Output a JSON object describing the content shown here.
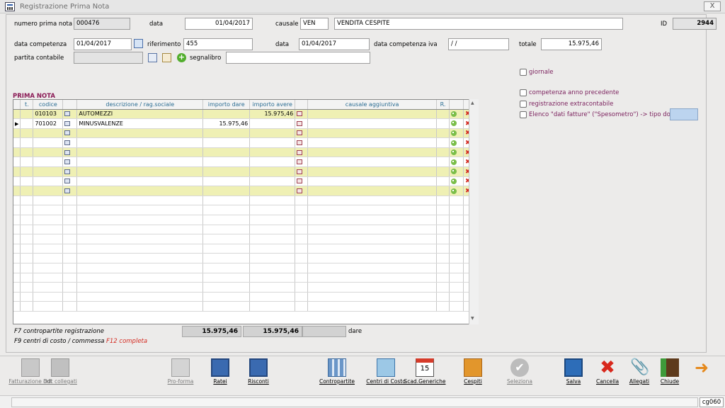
{
  "window": {
    "title": "Registrazione Prima Nota",
    "close_label": "X"
  },
  "header": {
    "numero_label": "numero prima nota",
    "numero_value": "000476",
    "data_label": "data",
    "data_value": "01/04/2017",
    "causale_label": "causale",
    "causale_code": "VEN",
    "causale_desc": "VENDITA CESPITE",
    "id_label": "ID",
    "id_value": "2944",
    "competenza_label": "data competenza",
    "competenza_value": "01/04/2017",
    "riferimento_label": "riferimento",
    "riferimento_value": "455",
    "data2_label": "data",
    "data2_value": "01/04/2017",
    "competenza_iva_label": "data competenza iva",
    "competenza_iva_value": "/ /",
    "totale_label": "totale",
    "totale_value": "15.975,46",
    "partita_label": "partita contabile",
    "partita_value": "",
    "segnalibro_label": "segnalibro",
    "segnalibro_value": ""
  },
  "options": {
    "giornale": "giornale",
    "competenza_precedente": "competenza anno precedente",
    "extracontabile": "registrazione extracontabile",
    "spesometro": "Elenco \"dati fatture\" (\"Spesometro\") -> tipo doc.",
    "tipo_doc_value": ""
  },
  "section_title": "PRIMA NOTA",
  "grid": {
    "columns": [
      "t.",
      "codice",
      "",
      "descrizione / rag.sociale",
      "importo dare",
      "importo avere",
      "",
      "causale aggiuntiva",
      "R.",
      "",
      ""
    ],
    "rows": [
      {
        "codice": "010103",
        "descrizione": "AUTOMEZZI",
        "dare": "",
        "avere": "15.975,46",
        "causale": "",
        "current": false
      },
      {
        "codice": "701002",
        "descrizione": "MINUSVALENZE",
        "dare": "15.975,46",
        "avere": "",
        "causale": "",
        "current": true
      }
    ],
    "empty_action_rows": 7,
    "blank_rows": 12
  },
  "footer": {
    "f7": "F7 contropartite registrazione",
    "f9": "F9 centri di costo / commessa",
    "f12": "F12 completa",
    "tot_dare": "15.975,46",
    "tot_avere": "15.975,46",
    "saldo": "",
    "saldo_label": "dare"
  },
  "toolbar": [
    {
      "name": "fatturazione-ddt-button",
      "icon": "doc-add-icon",
      "label": "Fatturazione ddt",
      "enabled": false
    },
    {
      "name": "ddt-collegati-button",
      "icon": "printer-icon",
      "label": "Ddt collegati",
      "enabled": false
    },
    {
      "name": "pro-forma-button",
      "icon": "doc-icon",
      "label": "Pro-forma",
      "enabled": false
    },
    {
      "name": "ratei-button",
      "icon": "calculator-icon",
      "label": "Ratei",
      "enabled": true
    },
    {
      "name": "risconti-button",
      "icon": "calculator-icon",
      "label": "Risconti",
      "enabled": true
    },
    {
      "name": "contropartite-button",
      "icon": "columns-icon",
      "label": "Contropartite",
      "enabled": true
    },
    {
      "name": "centri-di-costo-button",
      "icon": "network-icon",
      "label": "Centri di Costo",
      "enabled": true
    },
    {
      "name": "scad-generiche-button",
      "icon": "calendar-icon",
      "label": "Scad.Generiche",
      "enabled": true
    },
    {
      "name": "cespiti-button",
      "icon": "truck-icon",
      "label": "Cespiti",
      "enabled": true
    },
    {
      "name": "seleziona-button",
      "icon": "check-circle-icon",
      "label": "Seleziona",
      "enabled": false
    },
    {
      "name": "salva-button",
      "icon": "floppy-icon",
      "label": "Salva",
      "enabled": true
    },
    {
      "name": "cancella-button",
      "icon": "red-x-icon",
      "label": "Cancella",
      "enabled": true
    },
    {
      "name": "allegati-button",
      "icon": "paperclip-icon",
      "label": "Allegati",
      "enabled": true
    },
    {
      "name": "chiude-button",
      "icon": "exit-door-icon",
      "label": "Chiude",
      "enabled": true
    },
    {
      "name": "next-button",
      "icon": "arrow-right-icon",
      "label": "",
      "enabled": true
    }
  ],
  "calendar_day": "15",
  "status": {
    "code": "cg060"
  },
  "colors": {
    "highlight_row": "#eff0b4",
    "section_title": "#8a1a55",
    "header_text": "#2b6d93"
  }
}
